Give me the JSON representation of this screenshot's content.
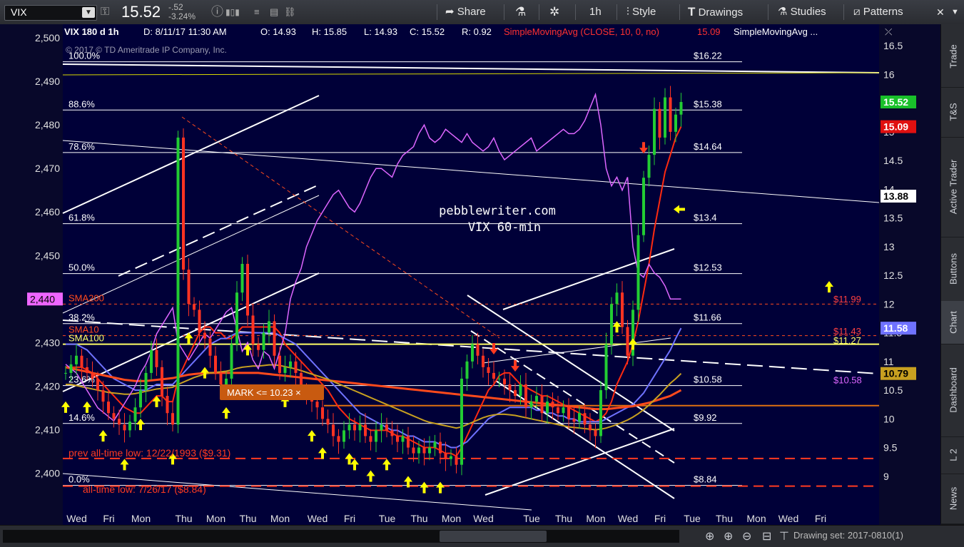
{
  "toolbar": {
    "symbol": "VIX",
    "last": "15.52",
    "change": "-.52",
    "change_pct": "-3.24%",
    "share": "Share",
    "timeframe": "1h",
    "style": "Style",
    "drawings": "Drawings",
    "studies": "Studies",
    "patterns": "Patterns"
  },
  "right_tabs": [
    "Trade",
    "T&S",
    "Active Trader",
    "Buttons",
    "Chart",
    "Dashboard",
    "L 2",
    "News"
  ],
  "bottom": {
    "drawing_set": "Drawing set: 2017-0810(1)"
  },
  "colors": {
    "bg": "#000038",
    "price_up": "#22cc33",
    "price_down": "#ff3322",
    "purple": "#dd66ff",
    "blue_ma": "#6f72ff",
    "orange_ma": "#ff4a1c",
    "gold_ma": "#c8a020"
  },
  "chart_data": {
    "type": "candlestick",
    "header": {
      "title": "VIX 180 d 1h",
      "date": "D: 8/11/17 11:30 AM",
      "open": "O: 14.93",
      "high": "H: 15.85",
      "low": "L: 14.93",
      "close": "C: 15.52",
      "range": "R: 0.92",
      "study1": "SimpleMovingAvg (CLOSE, 10, 0, no)",
      "study1_value": "15.09",
      "study2": "SimpleMovingAvg ..."
    },
    "copyright": "© 2017 © TD Ameritrade IP Company, Inc.",
    "watermark": [
      "pebblewriter.com",
      "VIX 60-min"
    ],
    "right_axis": {
      "ylim": [
        8.6,
        16.75
      ],
      "ticks": [
        "16.5",
        "16",
        "15.5",
        "15",
        "14.5",
        "14",
        "13.5",
        "13",
        "12.5",
        "12",
        "11.5",
        "11",
        "10.5",
        "10",
        "9.5",
        "9"
      ]
    },
    "left_axis": {
      "ylim": [
        2394,
        2501.5
      ],
      "ticks": [
        "2,500",
        "2,490",
        "2,480",
        "2,470",
        "2,460",
        "2,450",
        "2,440",
        "2,430",
        "2,420",
        "2,410",
        "2,400"
      ]
    },
    "x_labels": [
      "Wed",
      "Fri",
      "Mon",
      "Thu",
      "Mon",
      "Thu",
      "Mon",
      "Wed",
      "Fri",
      "Tue",
      "Thu",
      "Mon",
      "Wed",
      "Tue",
      "Thu",
      "Mon",
      "Wed",
      "Fri",
      "Tue",
      "Thu",
      "Mon",
      "Wed",
      "Fri"
    ],
    "x_label_index": [
      1,
      7,
      13,
      21,
      27,
      33,
      39,
      46,
      52,
      59,
      65,
      71,
      77,
      86,
      92,
      98,
      104,
      110,
      116,
      122,
      128,
      134,
      140
    ],
    "fib_levels": [
      {
        "label": "100.0%",
        "price": 16.22,
        "price_label": "$16.22"
      },
      {
        "label": "88.6%",
        "price": 15.38,
        "price_label": "$15.38"
      },
      {
        "label": "78.6%",
        "price": 14.64,
        "price_label": "$14.64"
      },
      {
        "label": "61.8%",
        "price": 13.4,
        "price_label": "$13.4"
      },
      {
        "label": "50.0%",
        "price": 12.53,
        "price_label": "$12.53"
      },
      {
        "label": "38.2%",
        "price": 11.66,
        "price_label": "$11.66"
      },
      {
        "label": "23.6%",
        "price": 10.58,
        "price_label": "$10.58"
      },
      {
        "label": "14.6%",
        "price": 9.92,
        "price_label": "$9.92"
      },
      {
        "label": "0.0%",
        "price": 8.84,
        "price_label": "$8.84"
      }
    ],
    "sma_labels": [
      {
        "label": "SMA200",
        "price": 12.0,
        "color": "#ff4a1c"
      },
      {
        "label": "SMA10",
        "price": 11.45,
        "color": "#ff4a1c"
      },
      {
        "label": "SMA100",
        "price": 11.3,
        "color": "#ffff66"
      }
    ],
    "annotations": {
      "prev_low": "prev all-time low: 12/22/1993 ($9.31)",
      "prev_low_price": 9.31,
      "all_low": "all-time low: 7/26/17 ($8.84)",
      "all_low_price": 8.84,
      "mark": "MARK <= 10.23 ×",
      "mark_price": 10.23
    },
    "right_labels": [
      {
        "text": "$11.99",
        "price": 11.99,
        "color": "#ff4040"
      },
      {
        "text": "$11.43",
        "price": 11.43,
        "color": "#ff4040"
      },
      {
        "text": "$11.27",
        "price": 11.27,
        "color": "#ffff66"
      },
      {
        "text": "$10.58",
        "price": 10.58,
        "color": "#dd66ff"
      }
    ],
    "badges": [
      {
        "text": "15.52",
        "price": 15.52,
        "bg": "#19c02a",
        "fg": "#ffffff"
      },
      {
        "text": "15.09",
        "price": 15.09,
        "bg": "#e01010",
        "fg": "#ffffff"
      },
      {
        "text": "13.88",
        "price": 13.88,
        "bg": "#ffffff",
        "fg": "#000000"
      },
      {
        "text": "11.58",
        "price": 11.58,
        "bg": "#6f72ff",
        "fg": "#ffffff"
      },
      {
        "text": "10.79",
        "price": 10.79,
        "bg": "#c8a020",
        "fg": "#000000"
      }
    ],
    "left_badge": {
      "text": "2,440",
      "value": 2440
    },
    "series": [
      {
        "name": "VIX",
        "values": [
          10.8,
          10.95,
          11.1,
          10.9,
          10.8,
          10.7,
          10.5,
          10.3,
          10.1,
          10.0,
          9.9,
          9.8,
          9.95,
          10.2,
          10.5,
          10.8,
          11.2,
          10.9,
          10.4,
          10.1,
          9.9,
          14.9,
          12.6,
          12.0,
          11.9,
          11.5,
          11.4,
          11.1,
          10.8,
          10.6,
          10.7,
          11.3,
          12.2,
          12.7,
          11.8,
          11.3,
          11.2,
          11.5,
          11.7,
          11.1,
          10.8,
          10.9,
          11.0,
          10.8,
          10.5,
          10.4,
          10.3,
          10.2,
          10.0,
          9.9,
          9.7,
          9.6,
          9.8,
          9.9,
          9.8,
          9.9,
          9.7,
          9.6,
          9.8,
          9.9,
          9.8,
          9.7,
          9.6,
          9.7,
          9.5,
          9.4,
          9.5,
          9.4,
          9.5,
          9.6,
          9.4,
          9.3,
          9.35,
          9.2,
          10.7,
          11.0,
          11.3,
          11.1,
          10.9,
          10.8,
          10.7,
          10.7,
          10.6,
          10.5,
          10.4,
          10.6,
          10.2,
          10.3,
          10.4,
          10.1,
          10.3,
          10.2,
          10.1,
          10.2,
          10.0,
          9.95,
          10.1,
          9.9,
          9.8,
          9.7,
          10.5,
          11.3,
          12.0,
          12.2,
          11.6,
          11.1,
          11.9,
          13.2,
          14.2,
          14.6,
          15.4,
          14.9,
          15.6,
          15.0,
          15.3,
          15.52
        ]
      },
      {
        "name": "SMA10",
        "values": [
          10.9,
          10.9,
          10.9,
          10.9,
          10.85,
          10.8,
          10.7,
          10.6,
          10.5,
          10.4,
          10.3,
          10.2,
          10.15,
          10.1,
          10.1,
          10.2,
          10.3,
          10.4,
          10.4,
          10.3,
          10.3,
          10.7,
          10.9,
          11.1,
          11.3,
          11.5,
          11.6,
          11.6,
          11.5,
          11.5,
          11.4,
          11.4,
          11.5,
          11.6,
          11.6,
          11.6,
          11.6,
          11.6,
          11.6,
          11.6,
          11.5,
          11.3,
          11.2,
          11.1,
          11.0,
          10.9,
          10.8,
          10.7,
          10.6,
          10.5,
          10.35,
          10.2,
          10.1,
          10.0,
          9.95,
          9.9,
          9.85,
          9.8,
          9.8,
          9.8,
          9.8,
          9.75,
          9.7,
          9.7,
          9.65,
          9.6,
          9.55,
          9.5,
          9.5,
          9.5,
          9.45,
          9.4,
          9.4,
          9.35,
          9.5,
          9.7,
          9.9,
          10.1,
          10.3,
          10.5,
          10.6,
          10.75,
          10.8,
          10.8,
          10.7,
          10.6,
          10.55,
          10.5,
          10.45,
          10.4,
          10.4,
          10.35,
          10.3,
          10.25,
          10.2,
          10.15,
          10.1,
          10.05,
          10.0,
          9.95,
          10.0,
          10.1,
          10.3,
          10.6,
          10.8,
          11.0,
          11.3,
          11.7,
          12.2,
          12.7,
          13.3,
          13.8,
          14.3,
          14.6,
          14.9,
          15.09
        ]
      },
      {
        "name": "SMA_blue",
        "values": [
          11.3,
          11.3,
          11.3,
          11.25,
          11.2,
          11.1,
          11.0,
          10.9,
          10.8,
          10.7,
          10.65,
          10.6,
          10.55,
          10.5,
          10.5,
          10.5,
          10.55,
          10.6,
          10.6,
          10.6,
          10.6,
          10.7,
          10.8,
          10.9,
          11.0,
          11.1,
          11.2,
          11.3,
          11.35,
          11.4,
          11.4,
          11.45,
          11.5,
          11.5,
          11.5,
          11.5,
          11.5,
          11.5,
          11.5,
          11.5,
          11.45,
          11.4,
          11.35,
          11.3,
          11.2,
          11.1,
          11.0,
          10.9,
          10.8,
          10.7,
          10.6,
          10.5,
          10.4,
          10.3,
          10.2,
          10.1,
          10.05,
          10.0,
          9.95,
          9.9,
          9.85,
          9.8,
          9.8,
          9.75,
          9.7,
          9.7,
          9.65,
          9.6,
          9.6,
          9.6,
          9.55,
          9.55,
          9.5,
          9.5,
          9.55,
          9.6,
          9.7,
          9.8,
          9.9,
          10.0,
          10.05,
          10.1,
          10.15,
          10.2,
          10.2,
          10.2,
          10.2,
          10.2,
          10.15,
          10.15,
          10.1,
          10.1,
          10.05,
          10.05,
          10.0,
          10.0,
          9.95,
          9.95,
          9.95,
          9.95,
          9.95,
          10.0,
          10.05,
          10.1,
          10.15,
          10.2,
          10.25,
          10.35,
          10.45,
          10.6,
          10.75,
          10.9,
          11.05,
          11.2,
          11.4,
          11.58
        ]
      },
      {
        "name": "SMA_orange",
        "values": [
          10.9,
          10.88,
          10.86,
          10.84,
          10.82,
          10.8,
          10.78,
          10.76,
          10.74,
          10.72,
          10.7,
          10.68,
          10.67,
          10.66,
          10.66,
          10.66,
          10.67,
          10.68,
          10.69,
          10.7,
          10.71,
          10.73,
          10.75,
          10.77,
          10.78,
          10.79,
          10.8,
          10.8,
          10.8,
          10.8,
          10.8,
          10.8,
          10.8,
          10.8,
          10.8,
          10.8,
          10.8,
          10.79,
          10.78,
          10.77,
          10.76,
          10.75,
          10.74,
          10.73,
          10.72,
          10.71,
          10.7,
          10.69,
          10.68,
          10.67,
          10.66,
          10.65,
          10.64,
          10.63,
          10.62,
          10.61,
          10.6,
          10.59,
          10.58,
          10.57,
          10.56,
          10.55,
          10.54,
          10.53,
          10.52,
          10.51,
          10.5,
          10.49,
          10.48,
          10.47,
          10.46,
          10.45,
          10.44,
          10.43,
          10.42,
          10.41,
          10.4,
          10.39,
          10.38,
          10.37,
          10.36,
          10.35,
          10.34,
          10.33,
          10.32,
          10.31,
          10.3,
          10.29,
          10.28,
          10.27,
          10.26,
          10.25,
          10.24,
          10.23,
          10.22,
          10.21,
          10.2,
          10.19,
          10.18,
          10.17,
          10.17,
          10.17,
          10.18,
          10.19,
          10.2,
          10.21,
          10.22,
          10.24,
          10.26,
          10.28,
          10.31,
          10.34,
          10.37,
          10.4,
          10.45,
          10.5
        ]
      },
      {
        "name": "SMA_gold",
        "values": [
          10.6,
          10.6,
          10.58,
          10.56,
          10.54,
          10.52,
          10.5,
          10.48,
          10.46,
          10.45,
          10.44,
          10.43,
          10.43,
          10.44,
          10.46,
          10.48,
          10.5,
          10.52,
          10.53,
          10.54,
          10.55,
          10.6,
          10.64,
          10.68,
          10.72,
          10.75,
          10.78,
          10.8,
          10.81,
          10.82,
          10.83,
          10.85,
          10.88,
          10.9,
          10.91,
          10.92,
          10.92,
          10.93,
          10.94,
          10.94,
          10.93,
          10.91,
          10.89,
          10.87,
          10.84,
          10.81,
          10.78,
          10.75,
          10.72,
          10.69,
          10.65,
          10.61,
          10.57,
          10.53,
          10.49,
          10.45,
          10.41,
          10.37,
          10.33,
          10.29,
          10.25,
          10.21,
          10.17,
          10.13,
          10.09,
          10.05,
          10.01,
          9.97,
          9.94,
          9.92,
          9.9,
          9.88,
          9.86,
          9.84,
          9.86,
          9.9,
          9.94,
          9.98,
          10.02,
          10.05,
          10.07,
          10.08,
          10.08,
          10.07,
          10.06,
          10.04,
          10.02,
          10.0,
          9.98,
          9.96,
          9.94,
          9.92,
          9.9,
          9.88,
          9.86,
          9.85,
          9.84,
          9.83,
          9.82,
          9.81,
          9.82,
          9.84,
          9.87,
          9.9,
          9.94,
          9.98,
          10.03,
          10.09,
          10.16,
          10.24,
          10.33,
          10.42,
          10.52,
          10.62,
          10.7,
          10.79
        ]
      },
      {
        "name": "SPX",
        "values": [
          2425,
          2424,
          2423,
          2421,
          2419,
          2417,
          2415,
          2414,
          2413,
          2412,
          2414,
          2416,
          2418,
          2420,
          2423,
          2425,
          2428,
          2432,
          2434,
          2436,
          2438,
          2430,
          2428,
          2426,
          2428,
          2430,
          2432,
          2431,
          2433,
          2435,
          2437,
          2438,
          2433,
          2428,
          2430,
          2426,
          2424,
          2428,
          2427,
          2424,
          2428,
          2432,
          2440,
          2444,
          2447,
          2452,
          2455,
          2458,
          2460,
          2462,
          2464,
          2465,
          2463,
          2461,
          2460,
          2462,
          2465,
          2468,
          2470,
          2470,
          2469,
          2468,
          2471,
          2473,
          2474,
          2475,
          2478,
          2480,
          2477,
          2476,
          2477,
          2479,
          2478,
          2477,
          2476,
          2478,
          2476,
          2475,
          2474,
          2475,
          2477,
          2474,
          2472,
          2473,
          2474,
          2475,
          2476,
          2477,
          2474,
          2475,
          2476,
          2477,
          2478,
          2479,
          2478,
          2478,
          2479,
          2481,
          2484,
          2487,
          2480,
          2470,
          2466,
          2468,
          2465,
          2468,
          2452,
          2446,
          2445,
          2448,
          2446,
          2445,
          2443,
          2440,
          2440,
          2440
        ]
      }
    ]
  }
}
